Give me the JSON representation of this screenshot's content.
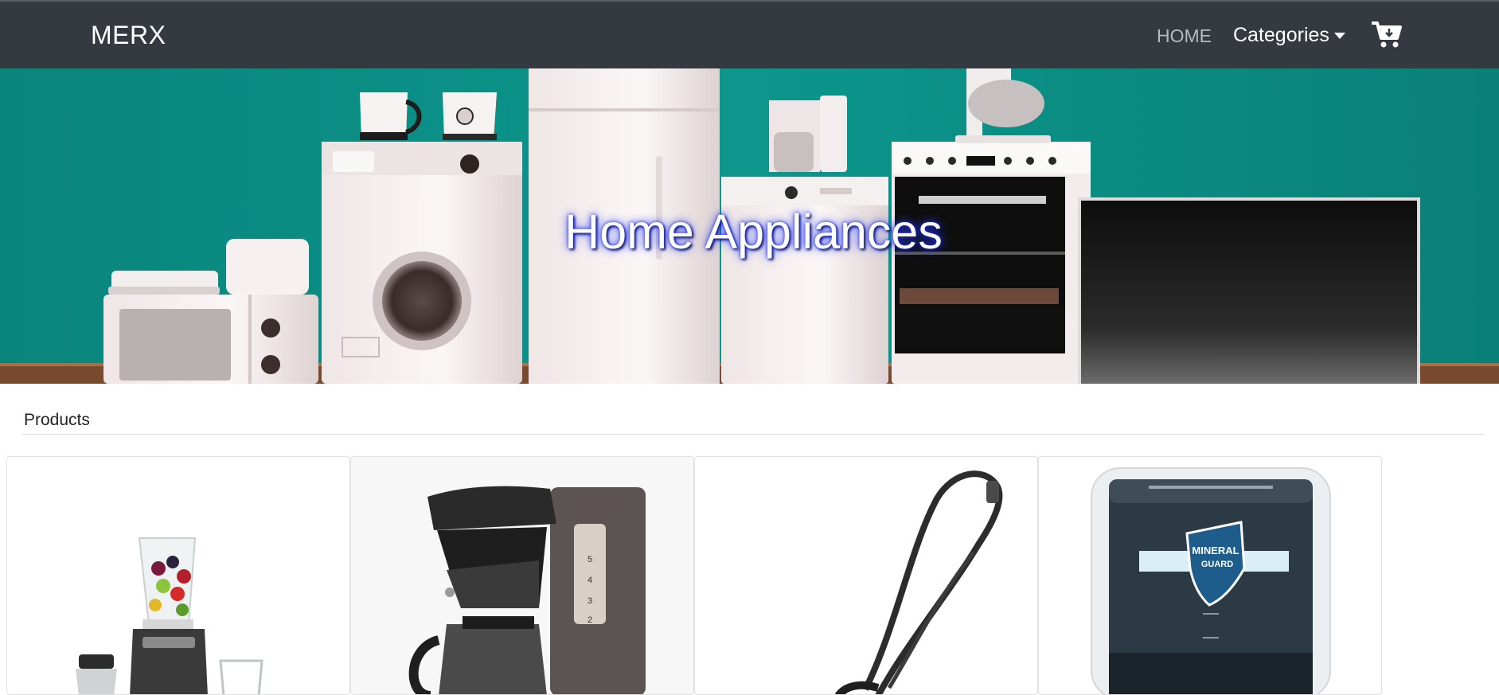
{
  "navbar": {
    "brand": "MERX",
    "home_label": "HOME",
    "categories_label": "Categories",
    "cart_icon": "cart-plus-icon",
    "background_color": "#343a40"
  },
  "hero": {
    "title": "Home Appliances",
    "background_color": "#0b8f86"
  },
  "products": {
    "header": "Products",
    "items": [
      {
        "image": "blender-image"
      },
      {
        "image": "coffee-maker-image"
      },
      {
        "image": "vacuum-cleaner-image"
      },
      {
        "image": "water-purifier-image"
      }
    ]
  }
}
